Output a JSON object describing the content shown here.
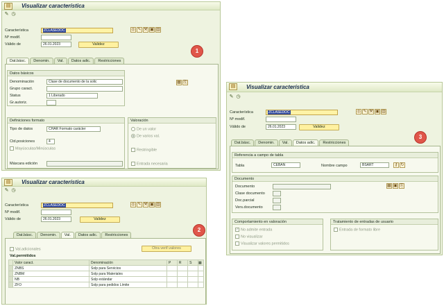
{
  "colors": {
    "window_bg": "#eef3e0",
    "highlight_field": "#fff3a6",
    "selection": "#334a9a",
    "badge": "#e0564a"
  },
  "title": "Visualizar característica",
  "header": {
    "caracteristica_label": "Característica",
    "caracteristica_value": "ZCLASEDOC",
    "modif_label": "Nº modif.",
    "valido_label": "Válido de",
    "valido_value": "26.01.2023",
    "validez_button": "Validez"
  },
  "toolbar_icons": [
    "pencil-icon",
    "clock-icon"
  ],
  "tabs": [
    "Dat.básc.",
    "Denomin.",
    "Val.",
    "Datos adic.",
    "Restricciones"
  ],
  "window1": {
    "badge": "1",
    "datos_basicos": {
      "header": "Datos básicos",
      "denominacion_label": "Denominación",
      "denominacion_value": "Clase de documento de la solic",
      "grupo_label": "Grupo caract.",
      "status_label": "Status",
      "status_value": "1 Liberado",
      "grautori_label": "Gr.autoriz."
    },
    "formato": {
      "header": "Definiciones formato",
      "tipo_label": "Tipo de datos",
      "tipo_value": "CHAR Formato carácter",
      "posiciones_label": "Ctd.posiciones",
      "posiciones_value": "4",
      "mayus_label": "Mayúsculas/Minúsculas",
      "mascara_label": "Máscara edición"
    },
    "valoracion": {
      "header": "Valoración",
      "un_valor": "De un valor",
      "varios": "De varios val.",
      "restringible": "Restringible",
      "entrada": "Entrada necesaria"
    }
  },
  "window2": {
    "badge": "2",
    "val_adicionales": "Val.adicionales",
    "otra_button": "Otra verif.valores",
    "table_title": "Val.permitidos",
    "columns": [
      "Valor caract.",
      "Denominación",
      "P",
      "R",
      "S"
    ],
    "rows": [
      {
        "value": "ZNBS",
        "desc": "Solp para Servicios"
      },
      {
        "value": "ZNBM",
        "desc": "Solp para Materiales"
      },
      {
        "value": "NB",
        "desc": "Solp estándar"
      },
      {
        "value": "ZFO",
        "desc": "Solp para pedidos Límite"
      }
    ]
  },
  "window3": {
    "badge": "3",
    "ref": {
      "header": "Referencia a campo de tabla",
      "tabla_label": "Tabla",
      "tabla_value": "CEBAN",
      "nombre_label": "Nombre campo",
      "nombre_value": "BSART"
    },
    "documento": {
      "header": "Documento",
      "doc_label": "Documento",
      "clase_label": "Clase documento",
      "parcial_label": "Doc.parcial",
      "version_label": "Vers.documento"
    },
    "comportamiento": {
      "header": "Comportamiento en valoración",
      "no_admite": "No admite entrada",
      "no_visualizar": "No visualizar",
      "visualizar": "Visualizar valores permitidos"
    },
    "tratamiento": {
      "header": "Tratamiento de entradas de usuario",
      "formato_libre": "Entrada de formato libre"
    }
  }
}
